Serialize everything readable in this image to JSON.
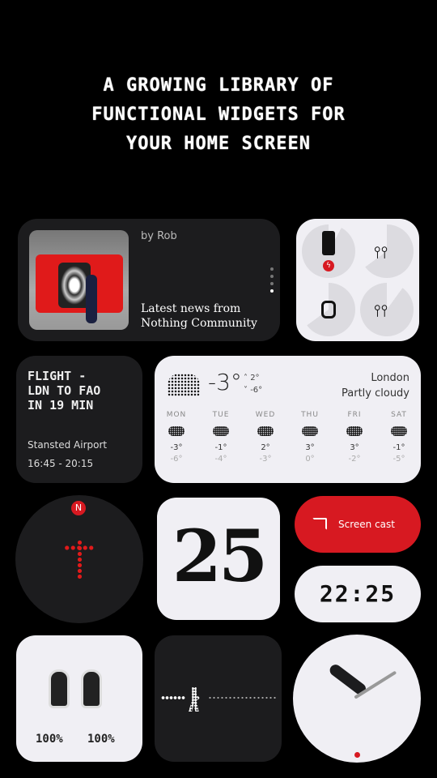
{
  "headline": [
    "A GROWING LIBRARY OF",
    "FUNCTIONAL WIDGETS FOR",
    "YOUR HOME SCREEN"
  ],
  "news": {
    "author": "by Rob",
    "title_line1": "Latest news from",
    "title_line2": "Nothing Community",
    "page_count": 4,
    "active_page": 4
  },
  "battery": {
    "devices": [
      {
        "icon": "phone-icon",
        "charging": true
      },
      {
        "icon": "earbuds-icon"
      },
      {
        "icon": "watch-icon"
      },
      {
        "icon": "earbuds-icon"
      }
    ]
  },
  "flight": {
    "line1": "FLIGHT -",
    "line2": "LDN TO FAO",
    "line3": "IN 19 MIN",
    "airport": "Stansted Airport",
    "times": "16:45 - 20:15"
  },
  "weather": {
    "temp": "-3°",
    "high": "2°",
    "low": "-6°",
    "city": "London",
    "condition": "Partly cloudy",
    "days": [
      {
        "d": "MON",
        "hi": "-3°",
        "lo": "-6°"
      },
      {
        "d": "TUE",
        "hi": "-1°",
        "lo": "-4°"
      },
      {
        "d": "WED",
        "hi": "2°",
        "lo": "-3°"
      },
      {
        "d": "THU",
        "hi": "3°",
        "lo": "0°"
      },
      {
        "d": "FRI",
        "hi": "3°",
        "lo": "-2°"
      },
      {
        "d": "SAT",
        "hi": "-1°",
        "lo": "-5°"
      }
    ]
  },
  "compass": {
    "north": "N"
  },
  "date": {
    "day": "25"
  },
  "screencast": {
    "label": "Screen cast"
  },
  "digital_clock": {
    "time": "22:25"
  },
  "earbuds": {
    "left": "100%",
    "right": "100%"
  },
  "colors": {
    "accent": "#d71921",
    "card_dark": "#1c1c1e",
    "card_light": "#f0eff4"
  }
}
